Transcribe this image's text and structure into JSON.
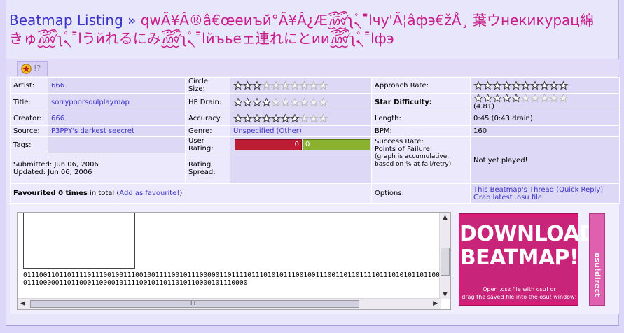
{
  "title": {
    "prefix": "Beatmap Listing »",
    "mapname": "qwÃ¥Â®â€œeиъй°Ã¥Â¿Æ꫞ʅ۫ܢ˭lчу'Ã¦âфэ€žÅ¸ 葉ウнекикурац綿 きゅ꫞ʅ۫ܢ˭lうйれるにみ꫞ʅ۫ܢ˭lйъьеェ連れにとии꫞ʅ۫ܢ˭lфэ"
  },
  "tabs": [
    {
      "label": "!?",
      "icon": "star-badge-icon"
    }
  ],
  "info": {
    "artist_label": "Artist:",
    "artist": "666",
    "circle_label": "Circle Size:",
    "circle_stars": 3,
    "ar_label": "Approach Rate:",
    "ar_stars": 10,
    "title_label": "Title:",
    "title_value": "sorrypoorsoulplaymap",
    "hp_label": "HP Drain:",
    "hp_stars": 4,
    "sd_label": "Star Difficulty:",
    "sd_stars": 4.81,
    "sd_value": "(4.81)",
    "creator_label": "Creator:",
    "creator": "666",
    "acc_label": "Accuracy:",
    "acc_stars": 7,
    "length_label": "Length:",
    "length": "0:45 (0:43 drain)",
    "source_label": "Source:",
    "source": "P3PPY's darkest seecret",
    "genre_label": "Genre:",
    "genre": "Unspecified (Other)",
    "bpm_label": "BPM:",
    "bpm": "160",
    "tags_label": "Tags:",
    "rating_label": "User Rating:",
    "rating_neg": "0",
    "rating_pos": "0",
    "success_label": "Success Rate:",
    "pof_label": "Points of Failure:",
    "pof_note": "(graph is accumulative, based on % at fail/retry)",
    "submitted_label": "Submitted:",
    "submitted": "Jun 06, 2006",
    "updated_label": "Updated:",
    "updated": "Jun 06, 2006",
    "spread_label": "Rating Spread:",
    "not_played": "Not yet played!",
    "fav_bold": "Favourited 0 times",
    "fav_rest": " in total (",
    "fav_link": "Add as favourite!",
    "fav_end": ")",
    "options_label": "Options:",
    "thread_link": "This Beatmap's Thread",
    "quick_reply": "(Quick Reply)",
    "grab_osu": "Grab latest .osu file"
  },
  "preview": {
    "bits": "0111001101101111011100100111001001111001011100000110111101110101011100100111001101101111011101010110110001110000011011000110000101111001011011010110000101110000"
  },
  "download": {
    "big": "DOWNLOAD BEATMAP!",
    "small1": "Open .osz file with osu! or",
    "small2": "drag the saved file into the osu! window!"
  },
  "direct": {
    "label": "osu!direct"
  },
  "colors": {
    "accent": "#3a34c8",
    "mapname": "#c81d8c",
    "download": "#d81c78"
  }
}
